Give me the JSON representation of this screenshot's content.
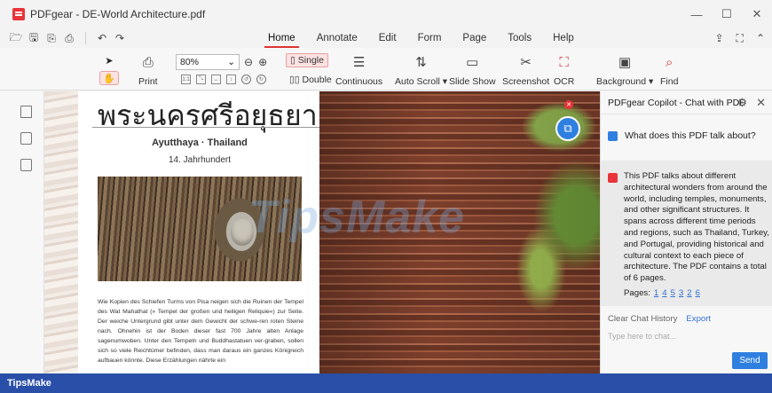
{
  "window": {
    "title": "PDFgear - DE-World Architecture.pdf",
    "controls": [
      "—",
      "☐",
      "✕"
    ]
  },
  "menu": {
    "tabs": [
      "Home",
      "Annotate",
      "Edit",
      "Form",
      "Page",
      "Tools",
      "Help"
    ],
    "active_tab": "Home"
  },
  "ribbon": {
    "print": "Print",
    "zoom_value": "80%",
    "single": "Single",
    "double": "Double",
    "continuous": "Continuous",
    "auto_scroll": "Auto Scroll ▾",
    "slide_show": "Slide Show",
    "screenshot": "Screenshot",
    "ocr": "OCR",
    "background": "Background ▾",
    "find": "Find"
  },
  "document": {
    "thai_title": "พระนครศรีอยุธยา",
    "subtitle": "Ayutthaya · Thailand",
    "century": "14. Jahrhundert",
    "body": "Wie Kopien des Schiefen Turms von Pisa neigen sich die Ruinen der Tempel des Wat Mahathat (» Tempel der großen und heiligen Reliquie«) zur Seite. Der weiche Untergrund gibt unter dem Gewicht der schwe-ren roten Steine nach. Ohnehin ist der Boden dieser fast 700 Jahre alten Anlage sagenumwoben. Unter den Tempeln und Buddhastatuen ver-graben, sollen sich so viele Reichtümer befinden, dass man daraus ein ganzes Königreich aufbauen könnte. Diese Erzählungen nährte ein",
    "watermark": "TipsMake"
  },
  "copilot": {
    "header": "PDFgear Copilot - Chat with PDF",
    "question": "What does this PDF talk about?",
    "answer": "This PDF talks about different architectural wonders from around the world, including temples, monuments, and other significant structures. It spans across different time periods and regions, such as Thailand, Turkey, and Portugal, providing historical and cultural context to each piece of architecture. The PDF contains a total of 6 pages.",
    "pages_label": "Pages:",
    "pages": [
      "1",
      "4",
      "5",
      "3",
      "2",
      "6"
    ],
    "clear_history": "Clear Chat History",
    "export": "Export",
    "input_placeholder": "Type here to chat...",
    "send": "Send"
  },
  "banner": {
    "text": "TipsMake"
  },
  "colors": {
    "accent_red": "#e8343a",
    "accent_blue": "#2f7fe0",
    "banner_blue": "#2a4fa8"
  }
}
